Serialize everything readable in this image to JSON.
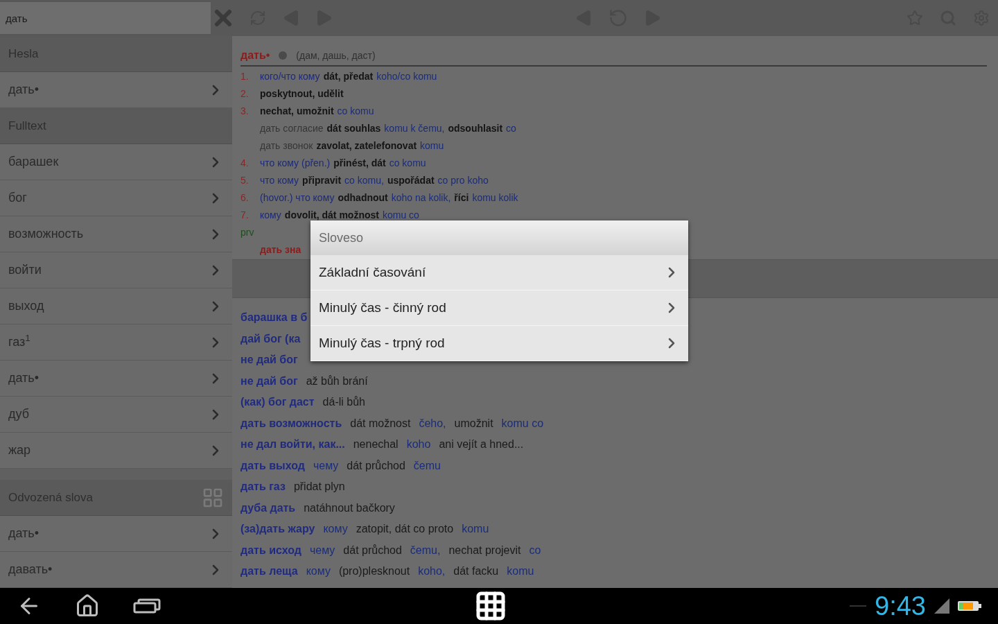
{
  "search": {
    "value": "дать"
  },
  "sidebar": {
    "sections": [
      {
        "title": "Hesla",
        "grid_icon": false,
        "items": [
          {
            "label": "дать•"
          }
        ]
      },
      {
        "title": "Fulltext",
        "grid_icon": false,
        "items": [
          {
            "label": "барашек"
          },
          {
            "label": "бог"
          },
          {
            "label": "возможность"
          },
          {
            "label": "войти"
          },
          {
            "label": "выход"
          },
          {
            "label": "газ$^{1}$"
          },
          {
            "label": "дать•"
          },
          {
            "label": "дуб"
          },
          {
            "label": "жар"
          }
        ]
      },
      {
        "title": "Odvozená slova",
        "grid_icon": true,
        "items": [
          {
            "label": "дать•"
          },
          {
            "label": "давать•"
          }
        ]
      }
    ]
  },
  "entry": {
    "headword": "дать•",
    "forms": "(дам, дашь, даст)",
    "lines": [
      {
        "number": "1.",
        "segments": [
          {
            "kind": "ru",
            "text": "кого/что кому"
          },
          {
            "kind": "cz",
            "text": "dát, předat"
          },
          {
            "kind": "hint",
            "text": "koho/co komu"
          }
        ]
      },
      {
        "number": "2.",
        "segments": [
          {
            "kind": "cz",
            "text": "poskytnout, udělit"
          }
        ]
      },
      {
        "number": "3.",
        "segments": [
          {
            "kind": "cz",
            "text": "nechat, umožnit"
          },
          {
            "kind": "hint",
            "text": "co komu"
          }
        ]
      },
      {
        "segments": [
          {
            "kind": "phrase",
            "text": "дать согласие"
          },
          {
            "kind": "cz",
            "text": "dát souhlas"
          },
          {
            "kind": "hint",
            "text": "komu k čemu,"
          },
          {
            "kind": "cz",
            "text": "odsouhlasit"
          },
          {
            "kind": "hint",
            "text": "co"
          }
        ]
      },
      {
        "segments": [
          {
            "kind": "phrase",
            "text": "дать звонок"
          },
          {
            "kind": "cz",
            "text": "zavolat, zatelefonovat"
          },
          {
            "kind": "hint",
            "text": "komu"
          }
        ]
      },
      {
        "number": "4.",
        "segments": [
          {
            "kind": "ru",
            "text": "что кому (přen.)"
          },
          {
            "kind": "cz",
            "text": "přinést, dát"
          },
          {
            "kind": "hint",
            "text": "co komu"
          }
        ]
      },
      {
        "number": "5.",
        "segments": [
          {
            "kind": "ru",
            "text": "что кому"
          },
          {
            "kind": "cz",
            "text": "připravit"
          },
          {
            "kind": "hint",
            "text": "co komu,"
          },
          {
            "kind": "cz",
            "text": "uspořádat"
          },
          {
            "kind": "hint",
            "text": "co pro koho"
          }
        ]
      },
      {
        "number": "6.",
        "segments": [
          {
            "kind": "ru",
            "text": "(hovor.) что кому"
          },
          {
            "kind": "cz",
            "text": "odhadnout"
          },
          {
            "kind": "hint",
            "text": "koho na kolik,"
          },
          {
            "kind": "cz",
            "text": "říci"
          },
          {
            "kind": "hint",
            "text": "komu kolik"
          }
        ]
      },
      {
        "number": "7.",
        "segments": [
          {
            "kind": "ru",
            "text": "кому"
          },
          {
            "kind": "cz",
            "text": "dovolit, dát možnost"
          },
          {
            "kind": "hint",
            "text": "komu co"
          }
        ]
      }
    ],
    "tag": "prv",
    "phrase_cut": "дать зна"
  },
  "fulltext": [
    {
      "segments": [
        {
          "kind": "ru",
          "text": "барашка в б"
        }
      ]
    },
    {
      "segments": [
        {
          "kind": "ru",
          "text": "дай бог (ка"
        }
      ]
    },
    {
      "segments": [
        {
          "kind": "ru",
          "text": "не дай бог"
        }
      ]
    },
    {
      "segments": [
        {
          "kind": "ru",
          "text": "не дай бог"
        },
        {
          "kind": "cz",
          "text": "až bůh brání"
        }
      ]
    },
    {
      "segments": [
        {
          "kind": "ru",
          "text": "(как) бог даст"
        },
        {
          "kind": "cz",
          "text": "dá-li bůh"
        }
      ]
    },
    {
      "segments": [
        {
          "kind": "ru",
          "text": "дать возможность"
        },
        {
          "kind": "cz",
          "text": "dát možnost"
        },
        {
          "kind": "hint",
          "text": "čeho,"
        },
        {
          "kind": "cz",
          "text": "umožnit"
        },
        {
          "kind": "hint",
          "text": "komu co"
        }
      ]
    },
    {
      "segments": [
        {
          "kind": "ru",
          "text": "не дал войти, как..."
        },
        {
          "kind": "cz",
          "text": "nenechal"
        },
        {
          "kind": "hint",
          "text": "koho"
        },
        {
          "kind": "cz",
          "text": "ani vejít a hned..."
        }
      ]
    },
    {
      "segments": [
        {
          "kind": "ru",
          "text": "дать выход"
        },
        {
          "kind": "ruhint",
          "text": "чему"
        },
        {
          "kind": "cz",
          "text": "dát průchod"
        },
        {
          "kind": "hint",
          "text": "čemu"
        }
      ]
    },
    {
      "segments": [
        {
          "kind": "ru",
          "text": "дать газ"
        },
        {
          "kind": "cz",
          "text": "přidat plyn"
        }
      ]
    },
    {
      "segments": [
        {
          "kind": "ru",
          "text": "дуба дать"
        },
        {
          "kind": "cz",
          "text": "natáhnout bačkory"
        }
      ]
    },
    {
      "segments": [
        {
          "kind": "ru",
          "text": "(за)дать жару"
        },
        {
          "kind": "ruhint",
          "text": "кому"
        },
        {
          "kind": "cz",
          "text": "zatopit, dát co proto"
        },
        {
          "kind": "hint",
          "text": "komu"
        }
      ]
    },
    {
      "segments": [
        {
          "kind": "ru",
          "text": "дать исход"
        },
        {
          "kind": "ruhint",
          "text": "чему"
        },
        {
          "kind": "cz",
          "text": "dát průchod"
        },
        {
          "kind": "hint",
          "text": "čemu,"
        },
        {
          "kind": "cz",
          "text": "nechat projevit"
        },
        {
          "kind": "hint",
          "text": "co"
        }
      ]
    },
    {
      "segments": [
        {
          "kind": "ru",
          "text": "дать леща"
        },
        {
          "kind": "ruhint",
          "text": "кому"
        },
        {
          "kind": "cz",
          "text": "(pro)plesknout"
        },
        {
          "kind": "hint",
          "text": "koho,"
        },
        {
          "kind": "cz",
          "text": "dát facku"
        },
        {
          "kind": "hint",
          "text": "komu"
        }
      ]
    }
  ],
  "dialog": {
    "title": "Sloveso",
    "items": [
      {
        "label": "Základní časování"
      },
      {
        "label": "Minulý čas - činný rod"
      },
      {
        "label": "Minulý čas - trpný rod"
      }
    ]
  },
  "status_bar": {
    "time": "9:43"
  }
}
